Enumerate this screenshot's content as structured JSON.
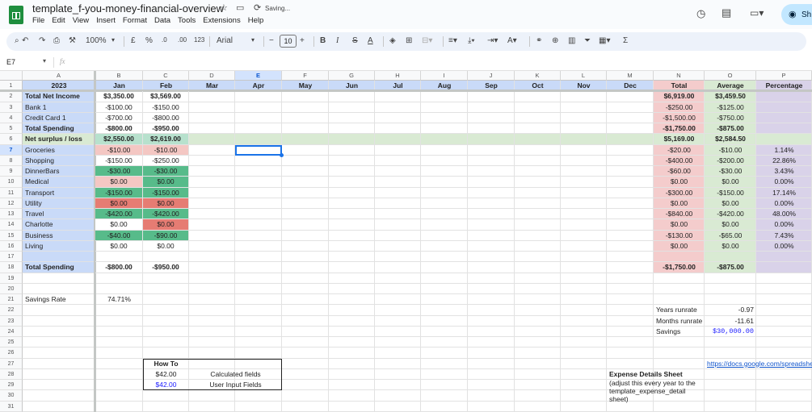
{
  "doc": {
    "title": "template_f-you-money-financial-overview",
    "saving": "Saving...",
    "menu": [
      "File",
      "Edit",
      "View",
      "Insert",
      "Format",
      "Data",
      "Tools",
      "Extensions",
      "Help"
    ],
    "share_label": "Sh"
  },
  "toolbar": {
    "zoom": "100%",
    "currency": "£",
    "percent": "%",
    "dec_less": ".0",
    "dec_more": ".00",
    "format123": "123",
    "font": "Arial",
    "font_size": "10",
    "bold": "B",
    "italic": "I",
    "strike": "S",
    "textcolor": "A",
    "functions": "Σ"
  },
  "formula_bar": {
    "cell_ref": "E7",
    "fx": "fx",
    "value": ""
  },
  "columns": [
    "A",
    "B",
    "C",
    "D",
    "E",
    "F",
    "G",
    "H",
    "I",
    "J",
    "K",
    "L",
    "M",
    "N",
    "O",
    "P"
  ],
  "row_numbers": [
    "1",
    "2",
    "3",
    "4",
    "5",
    "6",
    "7",
    "8",
    "9",
    "10",
    "11",
    "12",
    "13",
    "14",
    "15",
    "16",
    "17",
    "18",
    "19",
    "20",
    "21",
    "22",
    "23",
    "24",
    "25",
    "26",
    "27",
    "28",
    "29",
    "30",
    "31"
  ],
  "header_row": [
    "2023",
    "Jan",
    "Feb",
    "Mar",
    "Apr",
    "May",
    "Jun",
    "Jul",
    "Aug",
    "Sep",
    "Oct",
    "Nov",
    "Dec",
    "Total",
    "Average",
    "Percentage"
  ],
  "rows": [
    {
      "a": "Total Net Income",
      "b": "$3,350.00",
      "c": "$3,569.00",
      "n": "$6,919.00",
      "o": "$3,459.50",
      "p": "",
      "bold": true
    },
    {
      "a": "Bank 1",
      "b": "-$100.00",
      "c": "-$150.00",
      "n": "-$250.00",
      "o": "-$125.00",
      "p": ""
    },
    {
      "a": "Credit Card 1",
      "b": "-$700.00",
      "c": "-$800.00",
      "n": "-$1,500.00",
      "o": "-$750.00",
      "p": ""
    },
    {
      "a": "Total Spending",
      "b": "-$800.00",
      "c": "-$950.00",
      "n": "-$1,750.00",
      "o": "-$875.00",
      "p": "",
      "bold": true
    },
    {
      "a": "Net surplus / loss",
      "b": "$2,550.00",
      "c": "$2,619.00",
      "n": "$5,169.00",
      "o": "$2,584.50",
      "p": "",
      "bold": true
    },
    {
      "a": "Groceries",
      "b": "-$10.00",
      "c": "-$10.00",
      "n": "-$20.00",
      "o": "-$10.00",
      "p": "1.14%"
    },
    {
      "a": "Shopping",
      "b": "-$150.00",
      "c": "-$250.00",
      "n": "-$400.00",
      "o": "-$200.00",
      "p": "22.86%"
    },
    {
      "a": "DinnerBars",
      "b": "-$30.00",
      "c": "-$30.00",
      "n": "-$60.00",
      "o": "-$30.00",
      "p": "3.43%"
    },
    {
      "a": "Medical",
      "b": "$0.00",
      "c": "$0.00",
      "n": "$0.00",
      "o": "$0.00",
      "p": "0.00%"
    },
    {
      "a": "Transport",
      "b": "-$150.00",
      "c": "-$150.00",
      "n": "-$300.00",
      "o": "-$150.00",
      "p": "17.14%"
    },
    {
      "a": "Utility",
      "b": "$0.00",
      "c": "$0.00",
      "n": "$0.00",
      "o": "$0.00",
      "p": "0.00%"
    },
    {
      "a": "Travel",
      "b": "-$420.00",
      "c": "-$420.00",
      "n": "-$840.00",
      "o": "-$420.00",
      "p": "48.00%"
    },
    {
      "a": "Charlotte",
      "b": "$0.00",
      "c": "$0.00",
      "n": "$0.00",
      "o": "$0.00",
      "p": "0.00%"
    },
    {
      "a": "Business",
      "b": "-$40.00",
      "c": "-$90.00",
      "n": "-$130.00",
      "o": "-$65.00",
      "p": "7.43%"
    },
    {
      "a": "Living",
      "b": "$0.00",
      "c": "$0.00",
      "n": "$0.00",
      "o": "$0.00",
      "p": "0.00%"
    },
    {
      "a": "",
      "b": "",
      "c": "",
      "n": "",
      "o": "",
      "p": ""
    },
    {
      "a": "Total Spending",
      "b": "-$800.00",
      "c": "-$950.00",
      "n": "-$1,750.00",
      "o": "-$875.00",
      "p": "",
      "bold": true
    }
  ],
  "savings_rate": {
    "label": "Savings Rate",
    "value": "74.71%"
  },
  "runrate": {
    "years_label": "Years runrate",
    "years_value": "-0.97",
    "months_label": "Months runrate",
    "months_value": "-11.61",
    "savings_label": "Savings",
    "savings_value": "$30,000.00"
  },
  "howto": {
    "title": "How To",
    "calc_value": "$42.00",
    "calc_label": "Calculated fields",
    "input_value": "$42.00",
    "input_label": "User Input Fields"
  },
  "expense": {
    "title": "Expense Details Sheet",
    "note": "(adjust this every year to the template_expense_detail sheet)",
    "link": "https://docs.google.com/spreadsheets"
  },
  "colors": {
    "header_blue": "#c9daf8",
    "col_a_blue": "#c9daf8",
    "total_pink": "#f4cccc",
    "avg_green": "#d9ead3",
    "pct_purple": "#d9d2e9",
    "net_green": "#d9ead3",
    "green_strong": "#57bb8a",
    "red_strong": "#e67c73",
    "red_light": "#f4c7c3",
    "green_light": "#b7e1cd"
  }
}
